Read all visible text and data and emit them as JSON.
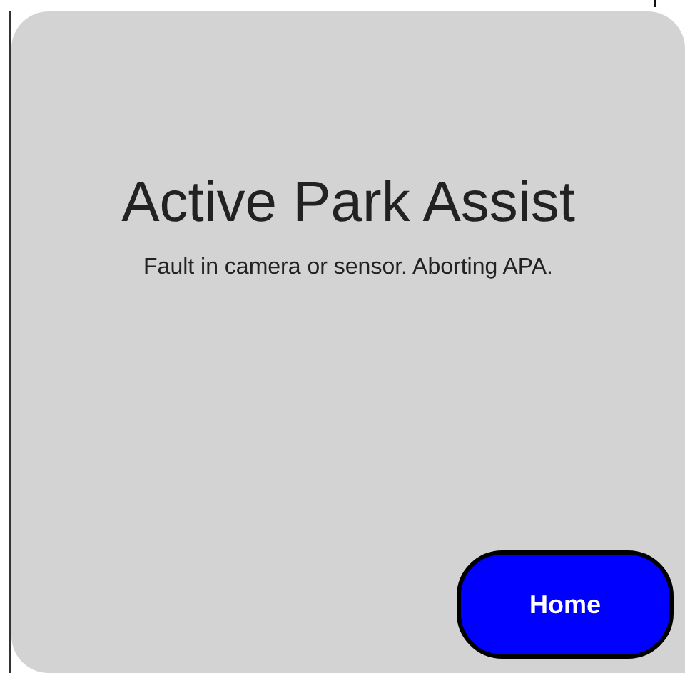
{
  "title": "Active Park Assist",
  "message": "Fault in camera or sensor. Aborting APA.",
  "buttons": [
    {
      "label": "Home"
    }
  ]
}
